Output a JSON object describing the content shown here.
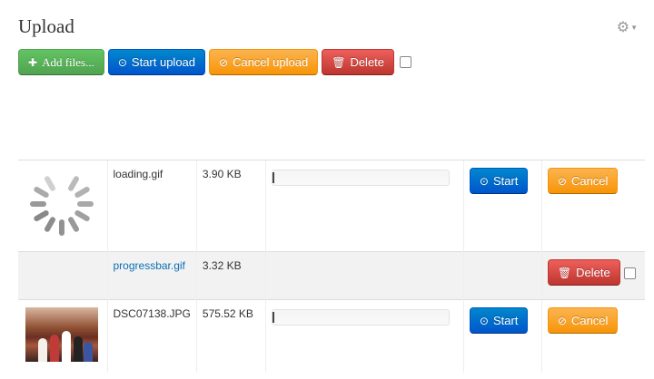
{
  "header": {
    "title": "Upload",
    "settings_icon": "gear-icon"
  },
  "toolbar": {
    "add_label": "Add files...",
    "start_label": "Start upload",
    "cancel_label": "Cancel upload",
    "delete_label": "Delete"
  },
  "files": [
    {
      "name": "loading.gif",
      "size": "3.90 KB",
      "state": "pending",
      "progress": 0,
      "start_label": "Start",
      "cancel_label": "Cancel",
      "preview": "spinner"
    },
    {
      "name": "progressbar.gif",
      "size": "3.32 KB",
      "state": "done",
      "delete_label": "Delete"
    },
    {
      "name": "DSC07138.JPG",
      "size": "575.52 KB",
      "state": "pending",
      "progress": 0,
      "start_label": "Start",
      "cancel_label": "Cancel",
      "preview": "photo"
    }
  ],
  "colors": {
    "success": "#51a351",
    "primary": "#0055cc",
    "warning": "#f89406",
    "danger": "#bd362f",
    "link": "#0a6fb5"
  }
}
